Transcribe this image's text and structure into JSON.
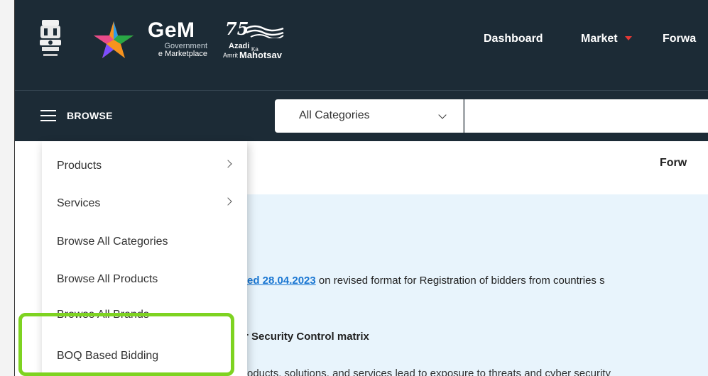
{
  "brand": {
    "gem_title": "GeM",
    "gem_sub_line1": "Government",
    "gem_sub_line2": "e Marketplace",
    "azadi_number": "75",
    "azadi_line1": "Azadi",
    "azadi_ka": "Ka",
    "azadi_amrit": "Amrit",
    "azadi_mahotsav": "Mahotsav"
  },
  "nav": {
    "dashboard": "Dashboard",
    "market": "Market",
    "forward": "Forwa"
  },
  "browse": {
    "label": "BROWSE",
    "category_selected": "All Categories",
    "search_placeholder": ""
  },
  "dropdown": {
    "items": [
      {
        "label": "Products",
        "has_submenu": true
      },
      {
        "label": "Services",
        "has_submenu": true
      },
      {
        "label": "Browse All Categories",
        "has_submenu": false
      },
      {
        "label": "Browse All Products",
        "has_submenu": false
      },
      {
        "label": "Browse All Brands",
        "has_submenu": false
      },
      {
        "label": "BOQ Based Bidding",
        "has_submenu": false
      }
    ]
  },
  "content": {
    "forw": "Forw",
    "notice_link": "ted 28.04.2023",
    "notice_text": " on revised format for Registration of bidders from countries s",
    "security_heading": "r Security Control matrix",
    "products_text": "oducts, solutions, and services lead to exposure to threats and cyber security"
  },
  "colors": {
    "header_bg": "#1c2b36",
    "accent_red": "#e53935",
    "highlight_green": "#7ed321",
    "link_blue": "#1976d2",
    "panel_bg": "#e8f4fc"
  }
}
